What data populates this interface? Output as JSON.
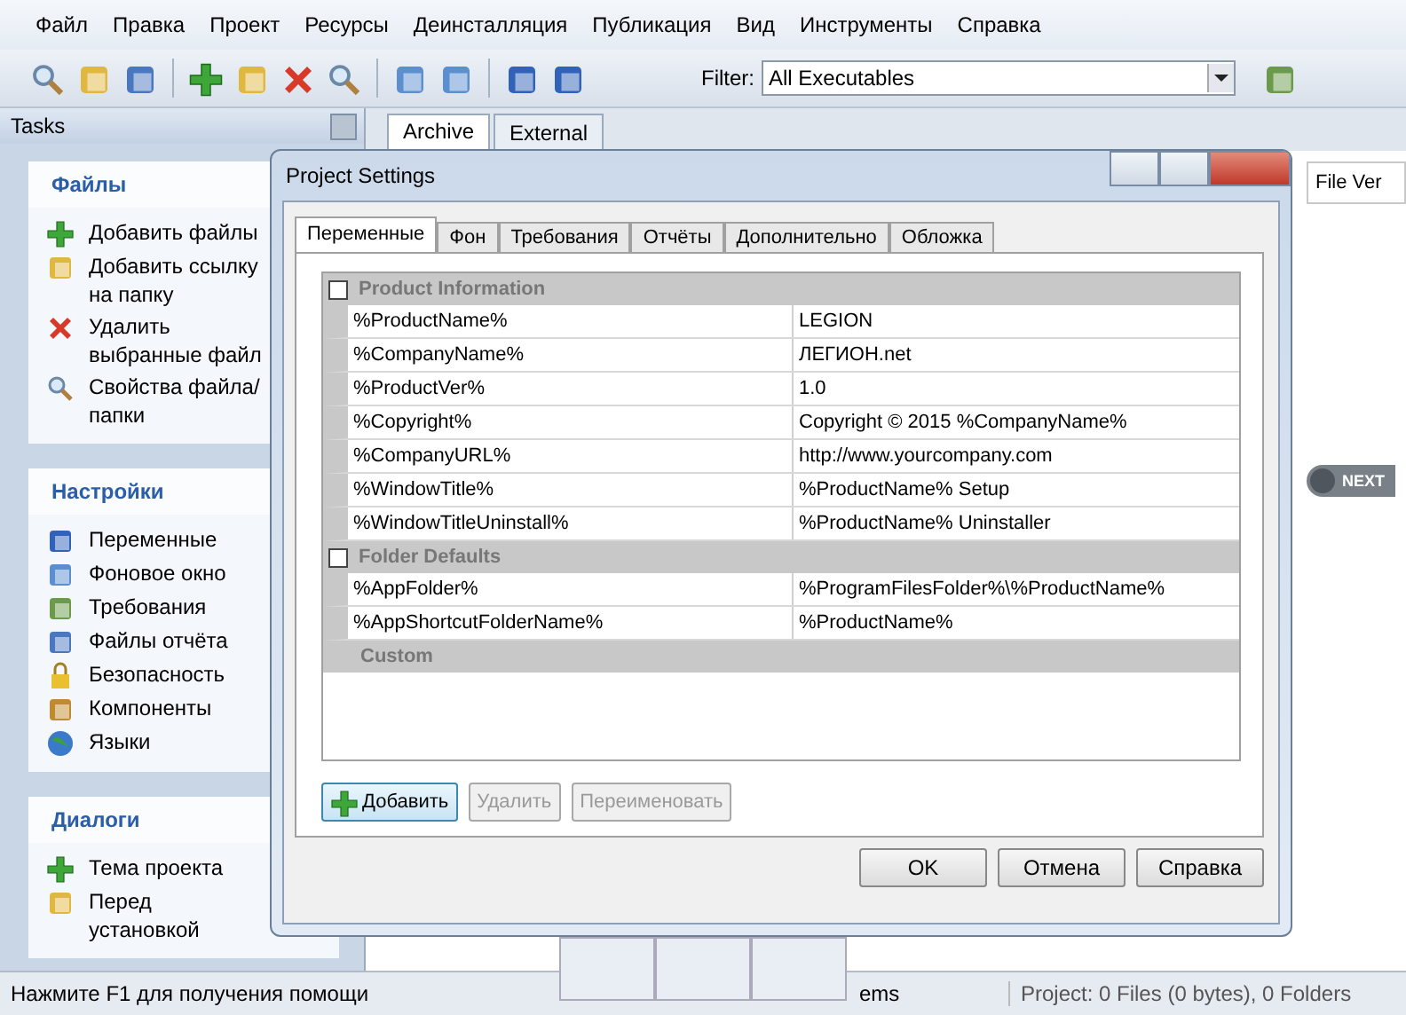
{
  "menu": [
    "Файл",
    "Правка",
    "Проект",
    "Ресурсы",
    "Деинсталляция",
    "Публикация",
    "Вид",
    "Инструменты",
    "Справка"
  ],
  "toolbar": {
    "filter_label": "Filter:",
    "filter_value": "All Executables"
  },
  "tasks_panel": {
    "title": "Tasks",
    "groups": [
      {
        "title": "Файлы",
        "items": [
          "Добавить файлы",
          "Добавить ссылку на папку",
          "Удалить выбранные файл",
          "Свойства файла/папки"
        ]
      },
      {
        "title": "Настройки",
        "items": [
          "Переменные",
          "Фоновое окно",
          "Требования",
          "Файлы отчёта",
          "Безопасность",
          "Компоненты",
          "Языки"
        ]
      },
      {
        "title": "Диалоги",
        "items": [
          "Тема проекта",
          "Перед установкой"
        ]
      }
    ]
  },
  "document_tabs": [
    {
      "label": "Archive",
      "selected": true
    },
    {
      "label": "External",
      "selected": false
    }
  ],
  "column_header": "File Ver",
  "next_button": "NEXT",
  "dialog": {
    "title": "Project Settings",
    "tabs": [
      {
        "label": "Переменные",
        "selected": true
      },
      {
        "label": "Фон",
        "selected": false
      },
      {
        "label": "Требования",
        "selected": false
      },
      {
        "label": "Отчёты",
        "selected": false
      },
      {
        "label": "Дополнительно",
        "selected": false
      },
      {
        "label": "Обложка",
        "selected": false
      }
    ],
    "groups": [
      {
        "title": "Product Information",
        "rows": [
          {
            "name": "%ProductName%",
            "value": "LEGION"
          },
          {
            "name": "%CompanyName%",
            "value": "ЛЕГИОН.net"
          },
          {
            "name": "%ProductVer%",
            "value": "1.0"
          },
          {
            "name": "%Copyright%",
            "value": "Copyright © 2015 %CompanyName%"
          },
          {
            "name": "%CompanyURL%",
            "value": "http://www.yourcompany.com"
          },
          {
            "name": "%WindowTitle%",
            "value": "%ProductName% Setup"
          },
          {
            "name": "%WindowTitleUninstall%",
            "value": "%ProductName% Uninstaller"
          }
        ]
      },
      {
        "title": "Folder Defaults",
        "rows": [
          {
            "name": "%AppFolder%",
            "value": "%ProgramFilesFolder%\\%ProductName%"
          },
          {
            "name": "%AppShortcutFolderName%",
            "value": "%ProductName%"
          }
        ]
      },
      {
        "title": "Custom"
      }
    ],
    "action_buttons": [
      {
        "label": "Добавить",
        "disabled": false
      },
      {
        "label": "Удалить",
        "disabled": true
      },
      {
        "label": "Переименовать",
        "disabled": true
      }
    ],
    "buttons": [
      "OK",
      "Отмена",
      "Справка"
    ]
  },
  "status_bar": {
    "hint": "Нажмите F1 для получения помощи",
    "middle": "ems",
    "project": "Project: 0 Files (0 bytes), 0 Folders"
  }
}
